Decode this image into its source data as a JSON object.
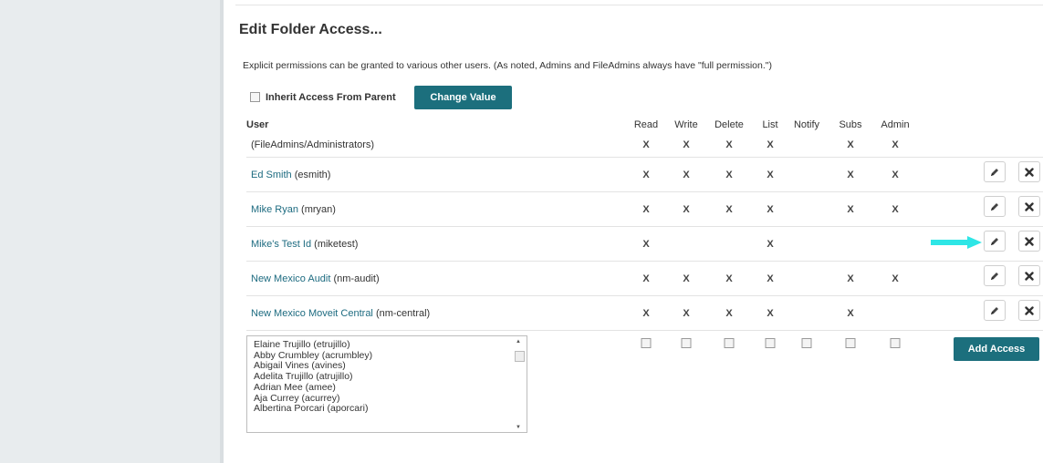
{
  "page": {
    "title": "Edit Folder Access...",
    "description": "Explicit permissions can be granted to various other users. (As noted, Admins and FileAdmins always have \"full permission.\")"
  },
  "inherit": {
    "label": "Inherit Access From Parent",
    "checked": false,
    "change_button": "Change Value"
  },
  "table": {
    "user_header": "User",
    "perm_headers": [
      "Read",
      "Write",
      "Delete",
      "List",
      "Notify",
      "Subs",
      "Admin"
    ],
    "rows": [
      {
        "name": "(FileAdmins/Administrators)",
        "id": "",
        "is_link": false,
        "perms": [
          "X",
          "X",
          "X",
          "X",
          "",
          "X",
          "X"
        ],
        "editable": false
      },
      {
        "name": "Ed Smith",
        "id": "(esmith)",
        "is_link": true,
        "perms": [
          "X",
          "X",
          "X",
          "X",
          "",
          "X",
          "X"
        ],
        "editable": true
      },
      {
        "name": "Mike Ryan",
        "id": "(mryan)",
        "is_link": true,
        "perms": [
          "X",
          "X",
          "X",
          "X",
          "",
          "X",
          "X"
        ],
        "editable": true
      },
      {
        "name": "Mike's Test Id",
        "id": "(miketest)",
        "is_link": true,
        "perms": [
          "X",
          "",
          "",
          "X",
          "",
          "",
          ""
        ],
        "editable": true
      },
      {
        "name": "New Mexico Audit ",
        "id": "(nm-audit)",
        "is_link": true,
        "perms": [
          "X",
          "X",
          "X",
          "X",
          "",
          "X",
          "X"
        ],
        "editable": true
      },
      {
        "name": "New Mexico Moveit Central",
        "id": "(nm-central)",
        "is_link": true,
        "perms": [
          "X",
          "X",
          "X",
          "X",
          "",
          "X",
          ""
        ],
        "editable": true
      }
    ]
  },
  "icons": {
    "edit": "pencil-icon",
    "delete": "x-icon",
    "pointer": "cyan-arrow-right"
  },
  "colors": {
    "accent": "#1c6f7d",
    "link": "#1d6b80",
    "arrow": "#2ee6e6"
  },
  "new_access": {
    "user_options": [
      "Elaine Trujillo  (etrujillo)",
      "Abby Crumbley  (acrumbley)",
      "Abigail Vines (avines)",
      "Adelita Trujillo (atrujillo)",
      "Adrian Mee (amee)",
      "Aja Currey (acurrey)",
      "Albertina Porcari (aporcari)"
    ],
    "add_button": "Add Access"
  }
}
